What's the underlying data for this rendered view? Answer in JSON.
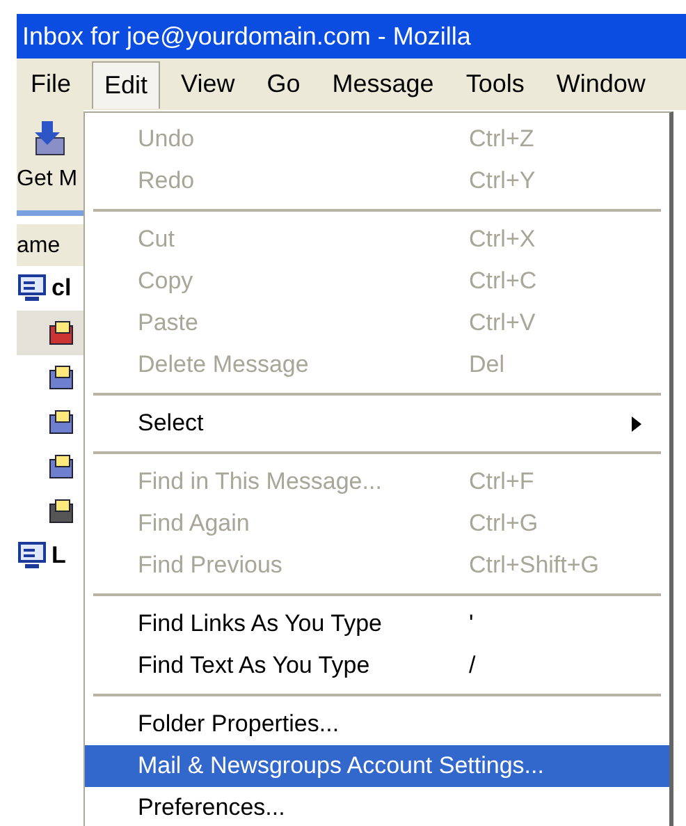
{
  "window": {
    "title": "Inbox for joe@yourdomain.com - Mozilla"
  },
  "menubar": [
    {
      "label": "File",
      "selected": false
    },
    {
      "label": "Edit",
      "selected": true
    },
    {
      "label": "View",
      "selected": false
    },
    {
      "label": "Go",
      "selected": false
    },
    {
      "label": "Message",
      "selected": false
    },
    {
      "label": "Tools",
      "selected": false
    },
    {
      "label": "Window",
      "selected": false
    }
  ],
  "toolbar": {
    "button_label": "Get M"
  },
  "folder_pane": {
    "column_header": "ame",
    "accounts": [
      {
        "label": "cl",
        "children": [
          {
            "kind": "special"
          },
          {
            "kind": "folder"
          },
          {
            "kind": "folder"
          },
          {
            "kind": "folder"
          },
          {
            "kind": "trash"
          }
        ]
      },
      {
        "label": "L"
      }
    ]
  },
  "edit_menu": [
    {
      "kind": "item",
      "label": "Undo",
      "shortcut": "Ctrl+Z",
      "disabled": true,
      "selected": false
    },
    {
      "kind": "item",
      "label": "Redo",
      "shortcut": "Ctrl+Y",
      "disabled": true,
      "selected": false
    },
    {
      "kind": "separator"
    },
    {
      "kind": "item",
      "label": "Cut",
      "shortcut": "Ctrl+X",
      "disabled": true,
      "selected": false
    },
    {
      "kind": "item",
      "label": "Copy",
      "shortcut": "Ctrl+C",
      "disabled": true,
      "selected": false
    },
    {
      "kind": "item",
      "label": "Paste",
      "shortcut": "Ctrl+V",
      "disabled": true,
      "selected": false
    },
    {
      "kind": "item",
      "label": "Delete Message",
      "shortcut": "Del",
      "disabled": true,
      "selected": false
    },
    {
      "kind": "separator"
    },
    {
      "kind": "submenu",
      "label": "Select",
      "disabled": false,
      "selected": false
    },
    {
      "kind": "separator"
    },
    {
      "kind": "item",
      "label": "Find in This Message...",
      "shortcut": "Ctrl+F",
      "disabled": true,
      "selected": false
    },
    {
      "kind": "item",
      "label": "Find Again",
      "shortcut": "Ctrl+G",
      "disabled": true,
      "selected": false
    },
    {
      "kind": "item",
      "label": "Find Previous",
      "shortcut": "Ctrl+Shift+G",
      "disabled": true,
      "selected": false
    },
    {
      "kind": "separator"
    },
    {
      "kind": "item",
      "label": "Find Links As You Type",
      "shortcut": "'",
      "disabled": false,
      "selected": false
    },
    {
      "kind": "item",
      "label": "Find Text As You Type",
      "shortcut": "/",
      "disabled": false,
      "selected": false
    },
    {
      "kind": "separator"
    },
    {
      "kind": "item",
      "label": "Folder Properties...",
      "disabled": false,
      "selected": false
    },
    {
      "kind": "item",
      "label": "Mail & Newsgroups Account Settings...",
      "disabled": false,
      "selected": true
    },
    {
      "kind": "item",
      "label": "Preferences...",
      "disabled": false,
      "selected": false
    }
  ]
}
